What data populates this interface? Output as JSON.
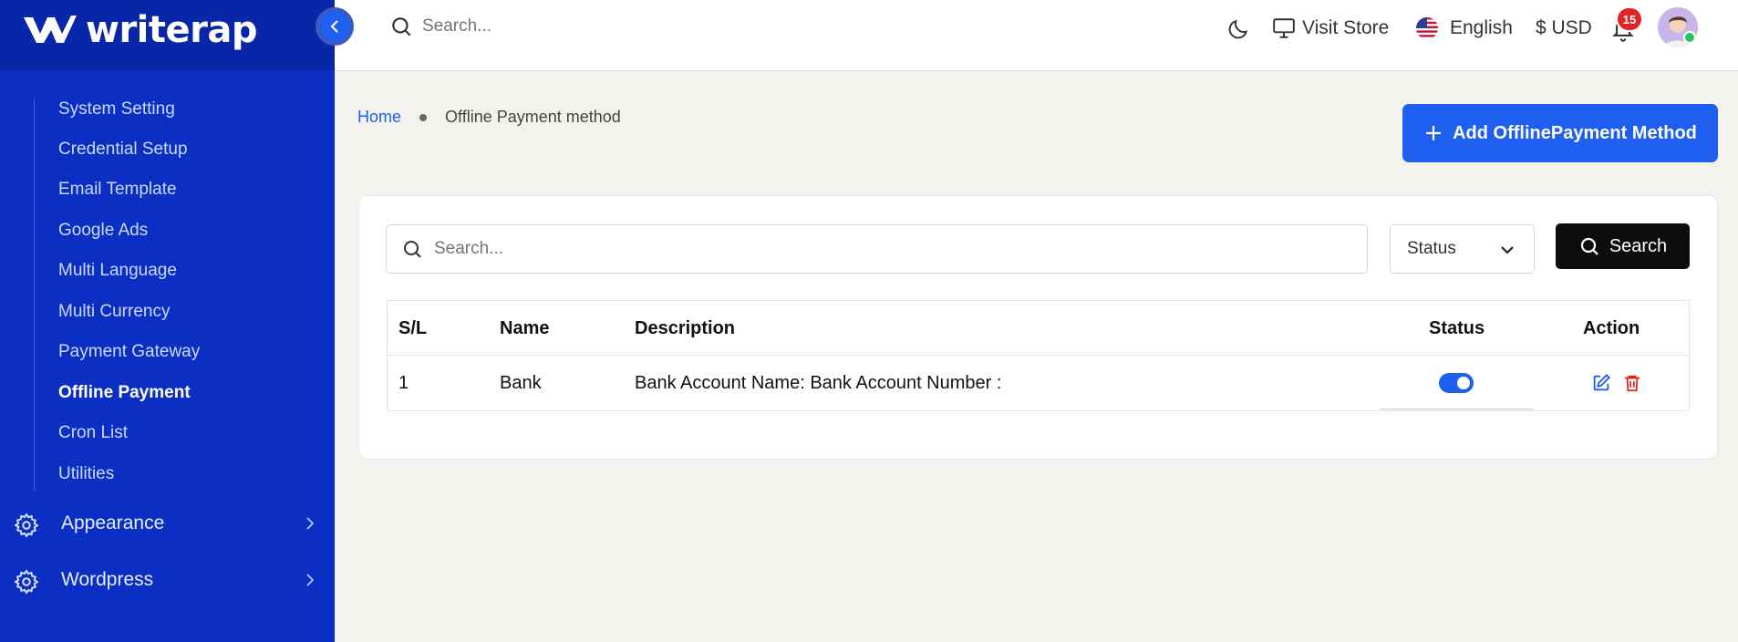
{
  "app": {
    "logo_text": "writerap"
  },
  "sidebar": {
    "sub_items": [
      {
        "label": "System Setting",
        "active": false
      },
      {
        "label": "Credential Setup",
        "active": false
      },
      {
        "label": "Email Template",
        "active": false
      },
      {
        "label": "Google Ads",
        "active": false
      },
      {
        "label": "Multi Language",
        "active": false
      },
      {
        "label": "Multi Currency",
        "active": false
      },
      {
        "label": "Payment Gateway",
        "active": false
      },
      {
        "label": "Offline Payment",
        "active": true
      },
      {
        "label": "Cron List",
        "active": false
      },
      {
        "label": "Utilities",
        "active": false
      }
    ],
    "nav_items": [
      {
        "label": "Appearance",
        "icon": "gear-icon"
      },
      {
        "label": "Wordpress",
        "icon": "gear-icon"
      }
    ]
  },
  "header": {
    "search_placeholder": "Search...",
    "visit_store": "Visit Store",
    "language": "English",
    "currency": "$ USD",
    "notification_count": "15"
  },
  "breadcrumb": {
    "home": "Home",
    "current": "Offline Payment method"
  },
  "actions": {
    "add_label": "Add OfflinePayment Method"
  },
  "filters": {
    "search_placeholder": "Search...",
    "status_label": "Status",
    "search_button": "Search"
  },
  "table": {
    "headers": {
      "sl": "S/L",
      "name": "Name",
      "description": "Description",
      "status": "Status",
      "action": "Action"
    },
    "rows": [
      {
        "sl": "1",
        "name": "Bank",
        "description": "Bank Account Name: Bank Account Number :",
        "status": true
      }
    ]
  },
  "colors": {
    "sidebar": "#0a2fc2",
    "primary": "#1e5ff0",
    "danger": "#e02424",
    "search_button": "#0d0d0d"
  }
}
